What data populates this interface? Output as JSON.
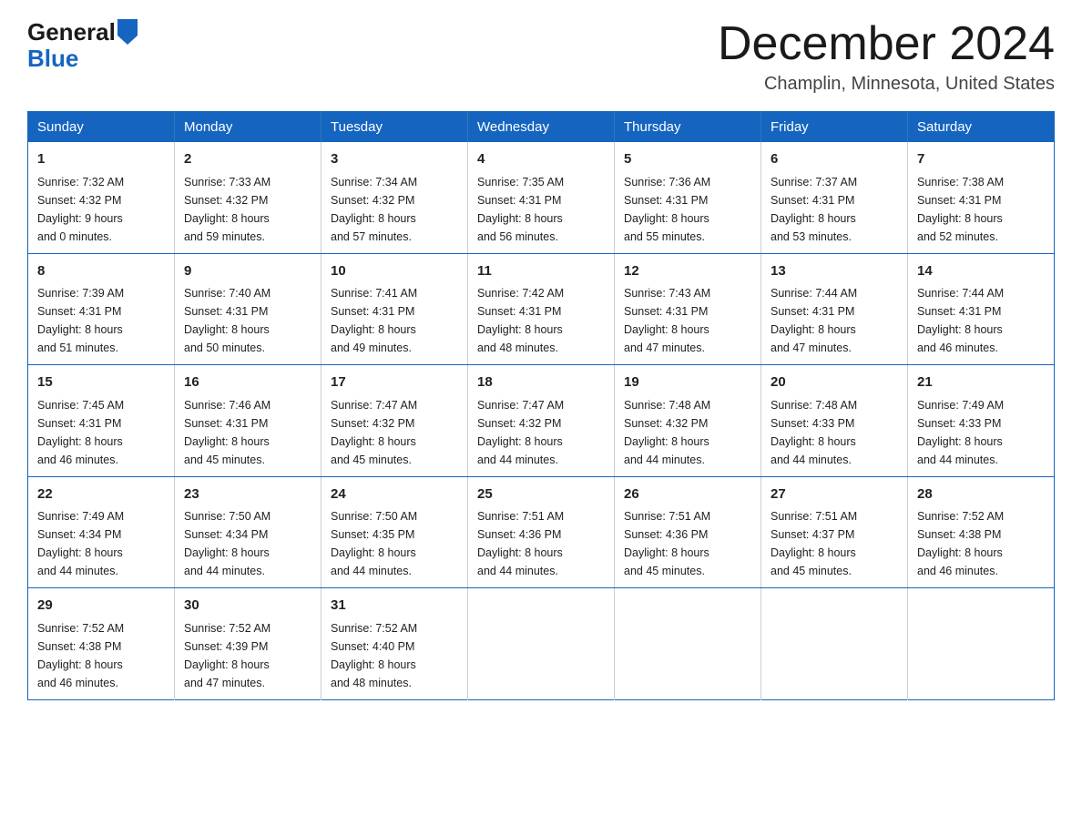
{
  "header": {
    "logo_general": "General",
    "logo_blue": "Blue",
    "month_title": "December 2024",
    "subtitle": "Champlin, Minnesota, United States"
  },
  "weekdays": [
    "Sunday",
    "Monday",
    "Tuesday",
    "Wednesday",
    "Thursday",
    "Friday",
    "Saturday"
  ],
  "weeks": [
    [
      {
        "day": "1",
        "sunrise": "7:32 AM",
        "sunset": "4:32 PM",
        "daylight": "9 hours and 0 minutes."
      },
      {
        "day": "2",
        "sunrise": "7:33 AM",
        "sunset": "4:32 PM",
        "daylight": "8 hours and 59 minutes."
      },
      {
        "day": "3",
        "sunrise": "7:34 AM",
        "sunset": "4:32 PM",
        "daylight": "8 hours and 57 minutes."
      },
      {
        "day": "4",
        "sunrise": "7:35 AM",
        "sunset": "4:31 PM",
        "daylight": "8 hours and 56 minutes."
      },
      {
        "day": "5",
        "sunrise": "7:36 AM",
        "sunset": "4:31 PM",
        "daylight": "8 hours and 55 minutes."
      },
      {
        "day": "6",
        "sunrise": "7:37 AM",
        "sunset": "4:31 PM",
        "daylight": "8 hours and 53 minutes."
      },
      {
        "day": "7",
        "sunrise": "7:38 AM",
        "sunset": "4:31 PM",
        "daylight": "8 hours and 52 minutes."
      }
    ],
    [
      {
        "day": "8",
        "sunrise": "7:39 AM",
        "sunset": "4:31 PM",
        "daylight": "8 hours and 51 minutes."
      },
      {
        "day": "9",
        "sunrise": "7:40 AM",
        "sunset": "4:31 PM",
        "daylight": "8 hours and 50 minutes."
      },
      {
        "day": "10",
        "sunrise": "7:41 AM",
        "sunset": "4:31 PM",
        "daylight": "8 hours and 49 minutes."
      },
      {
        "day": "11",
        "sunrise": "7:42 AM",
        "sunset": "4:31 PM",
        "daylight": "8 hours and 48 minutes."
      },
      {
        "day": "12",
        "sunrise": "7:43 AM",
        "sunset": "4:31 PM",
        "daylight": "8 hours and 47 minutes."
      },
      {
        "day": "13",
        "sunrise": "7:44 AM",
        "sunset": "4:31 PM",
        "daylight": "8 hours and 47 minutes."
      },
      {
        "day": "14",
        "sunrise": "7:44 AM",
        "sunset": "4:31 PM",
        "daylight": "8 hours and 46 minutes."
      }
    ],
    [
      {
        "day": "15",
        "sunrise": "7:45 AM",
        "sunset": "4:31 PM",
        "daylight": "8 hours and 46 minutes."
      },
      {
        "day": "16",
        "sunrise": "7:46 AM",
        "sunset": "4:31 PM",
        "daylight": "8 hours and 45 minutes."
      },
      {
        "day": "17",
        "sunrise": "7:47 AM",
        "sunset": "4:32 PM",
        "daylight": "8 hours and 45 minutes."
      },
      {
        "day": "18",
        "sunrise": "7:47 AM",
        "sunset": "4:32 PM",
        "daylight": "8 hours and 44 minutes."
      },
      {
        "day": "19",
        "sunrise": "7:48 AM",
        "sunset": "4:32 PM",
        "daylight": "8 hours and 44 minutes."
      },
      {
        "day": "20",
        "sunrise": "7:48 AM",
        "sunset": "4:33 PM",
        "daylight": "8 hours and 44 minutes."
      },
      {
        "day": "21",
        "sunrise": "7:49 AM",
        "sunset": "4:33 PM",
        "daylight": "8 hours and 44 minutes."
      }
    ],
    [
      {
        "day": "22",
        "sunrise": "7:49 AM",
        "sunset": "4:34 PM",
        "daylight": "8 hours and 44 minutes."
      },
      {
        "day": "23",
        "sunrise": "7:50 AM",
        "sunset": "4:34 PM",
        "daylight": "8 hours and 44 minutes."
      },
      {
        "day": "24",
        "sunrise": "7:50 AM",
        "sunset": "4:35 PM",
        "daylight": "8 hours and 44 minutes."
      },
      {
        "day": "25",
        "sunrise": "7:51 AM",
        "sunset": "4:36 PM",
        "daylight": "8 hours and 44 minutes."
      },
      {
        "day": "26",
        "sunrise": "7:51 AM",
        "sunset": "4:36 PM",
        "daylight": "8 hours and 45 minutes."
      },
      {
        "day": "27",
        "sunrise": "7:51 AM",
        "sunset": "4:37 PM",
        "daylight": "8 hours and 45 minutes."
      },
      {
        "day": "28",
        "sunrise": "7:52 AM",
        "sunset": "4:38 PM",
        "daylight": "8 hours and 46 minutes."
      }
    ],
    [
      {
        "day": "29",
        "sunrise": "7:52 AM",
        "sunset": "4:38 PM",
        "daylight": "8 hours and 46 minutes."
      },
      {
        "day": "30",
        "sunrise": "7:52 AM",
        "sunset": "4:39 PM",
        "daylight": "8 hours and 47 minutes."
      },
      {
        "day": "31",
        "sunrise": "7:52 AM",
        "sunset": "4:40 PM",
        "daylight": "8 hours and 48 minutes."
      },
      null,
      null,
      null,
      null
    ]
  ],
  "labels": {
    "sunrise": "Sunrise:",
    "sunset": "Sunset:",
    "daylight": "Daylight:"
  }
}
